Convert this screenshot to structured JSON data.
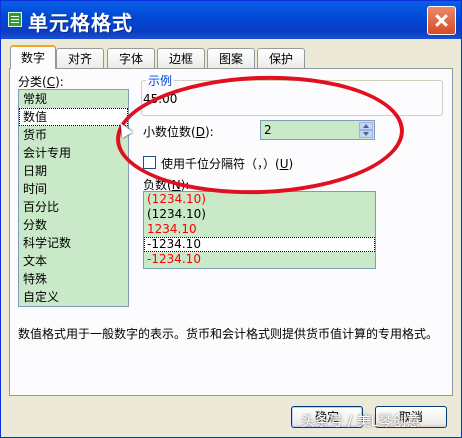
{
  "window": {
    "title": "单元格格式",
    "close_icon": "close-icon"
  },
  "tabs": [
    {
      "label": "数字",
      "active": true
    },
    {
      "label": "对齐"
    },
    {
      "label": "字体"
    },
    {
      "label": "边框"
    },
    {
      "label": "图案"
    },
    {
      "label": "保护"
    }
  ],
  "category": {
    "label": "分类",
    "hotkey": "C",
    "items": [
      "常规",
      "数值",
      "货币",
      "会计专用",
      "日期",
      "时间",
      "百分比",
      "分数",
      "科学记数",
      "文本",
      "特殊",
      "自定义"
    ],
    "selected": "数值"
  },
  "sample": {
    "legend": "示例",
    "value": "45.00"
  },
  "decimals": {
    "label": "小数位数",
    "hotkey": "D",
    "value": "2"
  },
  "thousands": {
    "label": "使用千位分隔符（，）",
    "hotkey": "U",
    "checked": false
  },
  "negative": {
    "label": "负数",
    "hotkey": "N",
    "items": [
      {
        "text": "(1234.10)",
        "color": "#ff0000"
      },
      {
        "text": "(1234.10)",
        "color": "#000000"
      },
      {
        "text": "1234.10",
        "color": "#ff0000"
      },
      {
        "text": "-1234.10",
        "color": "#000000"
      },
      {
        "text": "-1234.10",
        "color": "#ff0000"
      }
    ],
    "selected_index": 3
  },
  "description": "数值格式用于一般数字的表示。货币和会计格式则提供货币值计算的专用格式。",
  "buttons": {
    "ok": "确定",
    "cancel": "取消"
  },
  "watermark": "头条号 / 美L琴创意",
  "colors": {
    "title_bar": "#0a5fe7",
    "list_bg": "#c9e9c9",
    "annotation": "#e01020"
  }
}
